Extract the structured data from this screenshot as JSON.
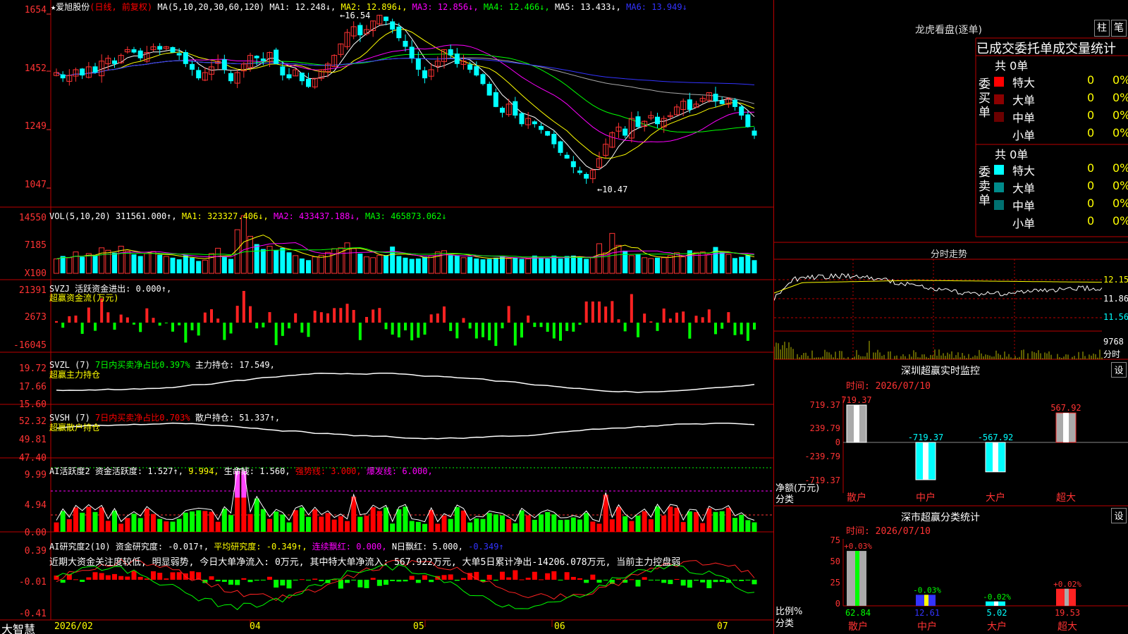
{
  "header": {
    "star": "★",
    "stock_name": "爱旭股份",
    "period": "(日线, 前复权)",
    "ma_label": "MA(5,10,20,30,60,120)",
    "ma1": "MA1: 12.248↓,",
    "ma2": "MA2: 12.896↓,",
    "ma3": "MA3: 12.856↓,",
    "ma4": "MA4: 12.466↓,",
    "ma5": "MA5: 13.433↓,",
    "ma6": "MA6: 13.949↓"
  },
  "price_panel": {
    "y_labels": [
      "1654",
      "1452",
      "1249",
      "1047"
    ],
    "high_mark": "16.54",
    "low_mark": "10.47"
  },
  "vol_panel": {
    "title": "VOL(5,10,20)",
    "value": "311561.000↑,",
    "ma1": "MA1: 323327.406↓,",
    "ma2": "MA2: 433437.188↓,",
    "ma3": "MA3: 465873.062↓",
    "y_labels": [
      "14550",
      "7185"
    ],
    "unit": "X100"
  },
  "svzj_panel": {
    "title": "SVZJ",
    "value": "活跃资金进出: 0.000↑,",
    "subtitle": "超赢资金流(万元)",
    "y_labels": [
      "21391",
      "2673",
      "-16045"
    ]
  },
  "svzl_panel": {
    "title": "SVZL (7)",
    "ratio": "7日内买卖净占比0.397%",
    "value": "主力持仓: 17.549,",
    "subtitle": "超赢主力持仓",
    "y_labels": [
      "19.72",
      "17.66",
      "15.60"
    ]
  },
  "svsh_panel": {
    "title": "SVSH (7)",
    "ratio": "7日内买卖净占比0.703%",
    "value": "散户持仓: 51.337↑,",
    "subtitle": "超赢散户持仓",
    "y_labels": [
      "52.32",
      "49.81",
      "47.40"
    ]
  },
  "ai_active_panel": {
    "title": "AI活跃度2",
    "v1": "资金活跃度: 1.527↑,",
    "v2": "9.994,",
    "v3": "生命线: 1.560,",
    "v4": "强势线: 3.000,",
    "v5": "爆发线: 6.000,",
    "y_labels": [
      "9.99",
      "4.94",
      "0.00"
    ]
  },
  "ai_research_panel": {
    "title": "AI研究度2(10)",
    "v1": "资金研究度: -0.017↑,",
    "v2": "平均研究度: -0.349↑,",
    "v3": "连续飘红: 0.000,",
    "v4": "N日飘红: 5.000,",
    "v5": "-0.349↑",
    "comment": "近期大资金关注度较低, 明显弱势, 今日大单净流入: 0万元, 其中特大单净流入: 567.922万元, 大单5日累计净出-14206.078万元, 当前主力控盘弱",
    "y_labels": [
      "0.39",
      "-0.01",
      "-0.41"
    ]
  },
  "x_axis": {
    "brand": "大智慧",
    "labels": [
      "2026/02",
      "04",
      "05",
      "06",
      "07"
    ]
  },
  "right_panel": {
    "lhb_title": "龙虎看盘(逐单)",
    "btn_zhu": "柱",
    "btn_bi": "笔",
    "stats_title": "已成交委托单成交量统计",
    "buy_label": "委买单",
    "sell_label": "委卖单",
    "buy_total": "共 0单",
    "sell_total": "共 0单",
    "buy_rows": [
      {
        "name": "特大",
        "count": "0",
        "pct": "0%",
        "color": "#ff0000"
      },
      {
        "name": "大单",
        "count": "0",
        "pct": "0%",
        "color": "#8b0000"
      },
      {
        "name": "中单",
        "count": "0",
        "pct": "0%",
        "color": "#6b0000"
      },
      {
        "name": "小单",
        "count": "0",
        "pct": "0%",
        "color": ""
      }
    ],
    "sell_rows": [
      {
        "name": "特大",
        "count": "0",
        "pct": "0%",
        "color": "#00ffff"
      },
      {
        "name": "大单",
        "count": "0",
        "pct": "0%",
        "color": "#008b8b"
      },
      {
        "name": "中单",
        "count": "0",
        "pct": "0%",
        "color": "#007070"
      },
      {
        "name": "小单",
        "count": "0",
        "pct": "0%",
        "color": ""
      }
    ],
    "intraday_title": "分时走势",
    "intraday_labels": [
      "12.15",
      "11.86",
      "11.56",
      "9768",
      "分时"
    ],
    "monitor_title": "深圳超赢实时监控",
    "monitor_btn": "设",
    "monitor_time": "时间: 2026/07/10",
    "monitor_y": [
      "719.37",
      "239.79",
      "0",
      "-239.79",
      "-719.37"
    ],
    "monitor_unit": "净额(万元)",
    "monitor_cat": "分类",
    "monitor_values": [
      "719.37",
      "-719.37",
      "-567.92",
      "567.92"
    ],
    "monitor_categories": [
      "散户",
      "中户",
      "大户",
      "超大"
    ],
    "class_title": "深市超赢分类统计",
    "class_btn": "设",
    "class_time": "时间: 2026/07/10",
    "class_y": [
      "75",
      "50",
      "25",
      "0"
    ],
    "class_unit": "比例%",
    "class_cat": "分类",
    "class_changes": [
      "+0.03%",
      "-0.03%",
      "-0.02%",
      "+0.02%"
    ],
    "class_values": [
      "62.84",
      "12.61",
      "5.02",
      "19.53"
    ],
    "class_categories": [
      "散户",
      "中户",
      "大户",
      "超大"
    ]
  },
  "chart_data": [
    {
      "type": "candlestick",
      "title": "爱旭股份 (日线, 前复权)",
      "y_ticks": [
        16.54,
        14.52,
        12.49,
        10.47
      ],
      "ylim": [
        10.47,
        16.54
      ],
      "x_labels": [
        "2026/02",
        "04",
        "05",
        "06",
        "07"
      ],
      "close": [
        14.5,
        14.3,
        14.4,
        14.6,
        14.4,
        14.7,
        14.5,
        14.9,
        15.0,
        14.8,
        15.1,
        15.3,
        15.2,
        15.0,
        15.2,
        15.4,
        15.3,
        15.4,
        15.2,
        15.1,
        14.8,
        14.6,
        14.3,
        14.5,
        14.7,
        14.9,
        14.6,
        14.2,
        14.5,
        14.8,
        15.1,
        15.0,
        14.9,
        15.2,
        14.8,
        14.4,
        14.3,
        14.6,
        14.2,
        14.0,
        14.3,
        14.6,
        14.8,
        15.1,
        15.5,
        15.9,
        16.1,
        15.8,
        16.0,
        16.3,
        16.5,
        16.3,
        16.0,
        15.7,
        15.4,
        15.0,
        14.6,
        14.3,
        14.6,
        14.9,
        15.3,
        15.1,
        14.8,
        14.9,
        14.6,
        14.4,
        14.1,
        13.7,
        13.3,
        13.1,
        13.4,
        13.0,
        12.7,
        12.9,
        12.7,
        12.5,
        12.3,
        12.0,
        11.7,
        11.5,
        11.2,
        11.0,
        10.8,
        11.1,
        11.5,
        12.0,
        12.4,
        12.6,
        12.3,
        12.9,
        12.6,
        12.8,
        13.0,
        12.7,
        12.9,
        13.0,
        13.3,
        13.5,
        13.2,
        13.4,
        13.6,
        13.8,
        13.5,
        13.4,
        13.6,
        13.3,
        13.0,
        12.6,
        12.3
      ]
    },
    {
      "type": "bar",
      "title": "VOL(5,10,20)",
      "ylim": [
        0,
        14550
      ],
      "values": [
        3500,
        4200,
        3800,
        5200,
        4000,
        4800,
        4400,
        6200,
        5600,
        5000,
        6600,
        5400,
        4600,
        4200,
        4800,
        5300,
        4500,
        4100,
        3800,
        3400,
        4400,
        3800,
        3000,
        3200,
        4800,
        6100,
        4000,
        3500,
        10600,
        14000,
        9000,
        7100,
        5900,
        6600,
        5600,
        6200,
        5100,
        4300,
        3600,
        3200,
        4000,
        4400,
        5100,
        6000,
        6200,
        7400,
        6000,
        4800,
        4000,
        3800,
        4400,
        4400,
        6500,
        4200,
        3800,
        3500,
        3600,
        4000,
        4300,
        5200,
        5500,
        4400,
        4400,
        3800,
        4000,
        3600,
        3400,
        3500,
        3800,
        4200,
        3600,
        3700,
        3500,
        3500,
        4300,
        3800,
        3600,
        4300,
        3600,
        4200,
        4300,
        4000,
        3500,
        3800,
        7200,
        5000,
        9700,
        6800,
        5500,
        4300,
        4600,
        3800,
        3600,
        3800,
        3800,
        4300,
        5000,
        4000,
        5600,
        5100,
        5200,
        4600,
        6400,
        5200,
        4600,
        3700,
        4000,
        4400,
        3200
      ],
      "series_values": {
        "MA1": 323327.406,
        "MA2": 433437.188,
        "MA3": 465873.062
      }
    }
  ]
}
